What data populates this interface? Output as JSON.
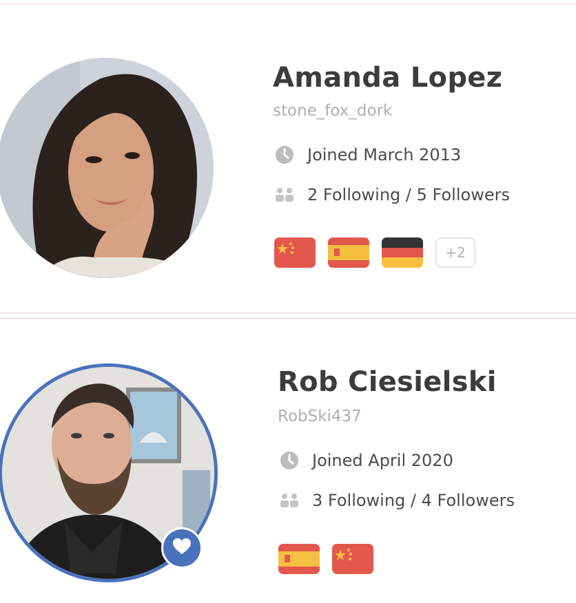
{
  "profiles": [
    {
      "name": "Amanda Lopez",
      "username": "stone_fox_dork",
      "joined": "Joined March 2013",
      "follow_stats": "2 Following / 5 Followers",
      "flags": [
        "flag-china",
        "flag-spain",
        "flag-germany"
      ],
      "more_flags": "+2",
      "avatar": "avatar-photo",
      "icons": {
        "clock": "clock-icon",
        "people": "people-icon"
      }
    },
    {
      "name": "Rob Ciesielski",
      "username": "RobSki437",
      "joined": "Joined April 2020",
      "follow_stats": "3 Following / 4 Followers",
      "flags": [
        "flag-spain",
        "flag-china"
      ],
      "avatar": "avatar-photo",
      "badge_icon": "heart-icon",
      "avatar_ring_color": "#4a72bc"
    }
  ],
  "colors": {
    "name": "#3c3c3c",
    "muted": "#afafaf",
    "meta": "#4b4b4b",
    "divider": "#f6c9cc",
    "china_red": "#e4574d",
    "spain_red": "#e4574d",
    "spain_yellow": "#f5c040",
    "germany_black": "#333333",
    "germany_red": "#e4574d",
    "germany_gold": "#f5c040"
  }
}
